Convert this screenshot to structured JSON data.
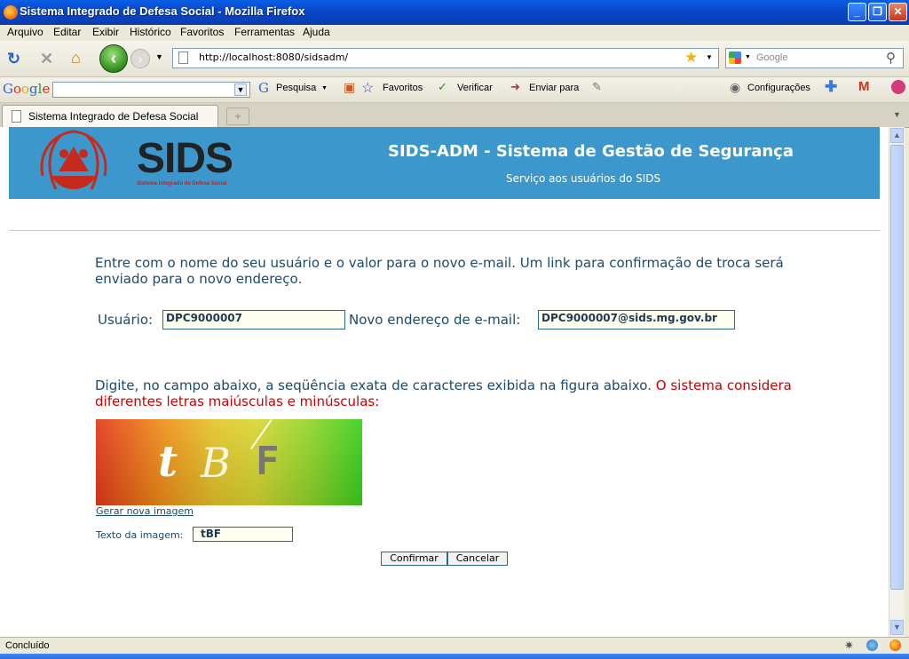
{
  "window": {
    "title": "Sistema Integrado de Defesa Social - Mozilla Firefox"
  },
  "menu": [
    "Arquivo",
    "Editar",
    "Exibir",
    "Histórico",
    "Favoritos",
    "Ferramentas",
    "Ajuda"
  ],
  "nav": {
    "url": "http://localhost:8080/sidsadm/",
    "search_placeholder": "Google"
  },
  "google_toolbar": {
    "logo": "Google",
    "items": [
      "Pesquisa",
      "Favoritos",
      "Verificar",
      "Enviar para",
      "Configurações"
    ]
  },
  "tab": {
    "label": "Sistema Integrado de Defesa Social"
  },
  "banner": {
    "logo_text": "SIDS",
    "logo_subtitle": "Sistema Integrado de Defesa Social",
    "title": "SIDS-ADM - Sistema de Gestão de Segurança",
    "subtitle": "Serviço aos usuários do SIDS"
  },
  "form": {
    "intro": "Entre com o nome do seu usuário e o valor para o novo e-mail. Um link para confirmação de troca será enviado para o novo endereço.",
    "user_label": "Usuário:",
    "user_value": "DPC9000007",
    "email_label": "Novo endereço de e-mail:",
    "email_value": "DPC9000007@sids.mg.gov.br",
    "captcha_instruction": "Digite, no campo abaixo, a seqüência exata de caracteres exibida na figura abaixo.",
    "captcha_warning": "O sistema considera diferentes letras maiúsculas e minúsculas:",
    "captcha_chars": [
      "t",
      "B",
      "F"
    ],
    "new_image_link": "Gerar nova imagem",
    "captcha_label": "Texto da imagem:",
    "captcha_value": "tBF",
    "confirm_label": "Confirmar",
    "cancel_label": "Cancelar"
  },
  "status": {
    "text": "Concluído"
  }
}
